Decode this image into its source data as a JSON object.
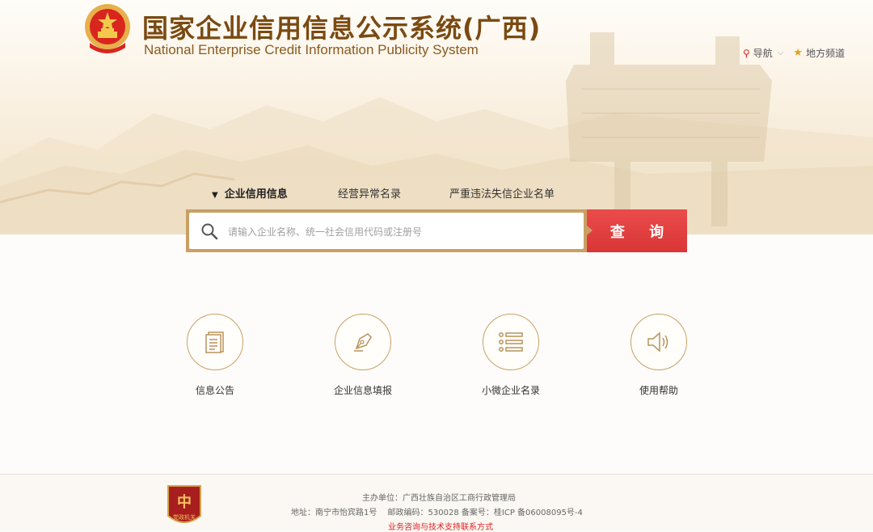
{
  "header": {
    "title_cn": "国家企业信用信息公示系统(广西)",
    "title_en": "National Enterprise Credit Information Publicity System",
    "nav_label": "导航",
    "local_channel": "地方频道"
  },
  "tabs": [
    {
      "label": "企业信用信息",
      "active": true
    },
    {
      "label": "经营异常名录",
      "active": false
    },
    {
      "label": "严重违法失信企业名单",
      "active": false
    }
  ],
  "search": {
    "placeholder": "请输入企业名称、统一社会信用代码或注册号",
    "button_label": "查 询"
  },
  "features": [
    {
      "label": "信息公告",
      "icon": "document-icon"
    },
    {
      "label": "企业信息填报",
      "icon": "pen-icon"
    },
    {
      "label": "小微企业名录",
      "icon": "list-icon"
    },
    {
      "label": "使用帮助",
      "icon": "speaker-icon"
    }
  ],
  "footer": {
    "sponsor": "主办单位：广西壮族自治区工商行政管理局",
    "address": "地址：南宁市怡宾路1号　 邮政编码：530028 备案号：桂ICP 备06008095号-4",
    "contact_link": "业务咨询与技术支持联系方式",
    "badge_text": "党政机关"
  },
  "colors": {
    "accent_gold": "#c9a064",
    "title_brown": "#7a4a12",
    "button_red": "#e04242"
  }
}
